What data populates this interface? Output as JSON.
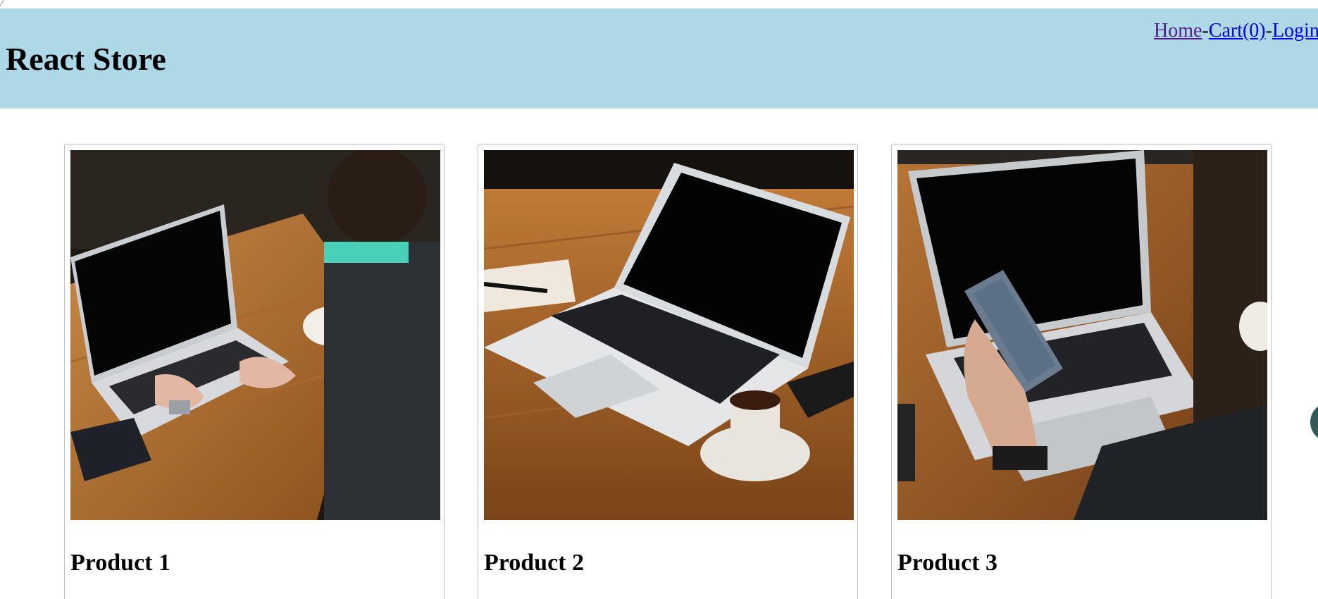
{
  "header": {
    "brand": "React Store",
    "nav": {
      "home": "Home",
      "sep1": "-",
      "cart": "Cart(0)",
      "sep2": "-",
      "login": "Login"
    },
    "background": "#add8e6"
  },
  "products": [
    {
      "name": "Product 1",
      "image_icon": "laptop-typing-photo"
    },
    {
      "name": "Product 2",
      "image_icon": "laptop-coffee-photo"
    },
    {
      "name": "Product 3",
      "image_icon": "laptop-phone-photo"
    }
  ],
  "colors": {
    "link": "#0000ee",
    "visited_link": "#551a8b",
    "card_border": "#bdbdbd",
    "floating_button": "#2f5a56"
  }
}
